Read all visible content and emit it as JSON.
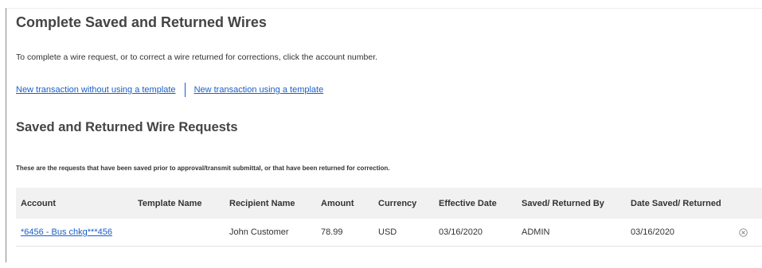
{
  "page": {
    "title": "Complete Saved and Returned Wires",
    "instructions": "To complete a wire request, or to correct a wire returned for corrections, click the account number."
  },
  "links": {
    "without_template": "New transaction without using a template",
    "with_template": "New transaction using a template"
  },
  "section": {
    "title": "Saved and Returned Wire Requests",
    "note": "These are the requests that have been saved prior to approval/transmit submittal, or that have been returned for correction."
  },
  "table": {
    "headers": {
      "account": "Account",
      "template_name": "Template Name",
      "recipient_name": "Recipient Name",
      "amount": "Amount",
      "currency": "Currency",
      "effective_date": "Effective Date",
      "saved_returned_by": "Saved/ Returned By",
      "date_saved_returned": "Date Saved/ Returned"
    },
    "rows": [
      {
        "account": "*6456 - Bus chkg***456",
        "template_name": "",
        "recipient_name": "John Customer",
        "amount": "78.99",
        "currency": "USD",
        "effective_date": "03/16/2020",
        "saved_returned_by": "ADMIN",
        "date_saved_returned": "03/16/2020",
        "action_icon": "close-circle-icon"
      }
    ]
  },
  "colors": {
    "link": "#1a5fc8",
    "header_bg": "#f1f1f1",
    "heading_text": "#444444",
    "body_text": "#333333"
  }
}
